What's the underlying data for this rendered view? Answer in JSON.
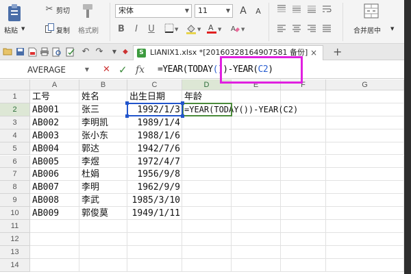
{
  "ribbon": {
    "paste_label": "粘贴",
    "cut_label": "剪切",
    "copy_label": "复制",
    "format_painter_label": "格式刷",
    "font_name": "宋体",
    "font_size": "11",
    "grow_font": "A",
    "shrink_font": "A",
    "bold": "B",
    "italic": "I",
    "underline": "U",
    "merge_label": "合并居中"
  },
  "tabbar": {
    "doc_title": "LIANIX1.xlsx *[20160328164907581 备份]",
    "doc_icon": "S",
    "close": "×",
    "add": "+"
  },
  "formula_bar": {
    "name_box": "AVERAGE",
    "cancel": "✕",
    "confirm": "✓",
    "fx": "fx",
    "formula_prefix": "=YEAR(TODAY",
    "formula_paren": "()",
    "formula_mid": ")-YEAR(",
    "formula_ref": "C2",
    "formula_end": ")"
  },
  "sheet": {
    "columns": [
      "A",
      "B",
      "C",
      "D",
      "E",
      "F",
      "G"
    ],
    "rows": [
      "1",
      "2",
      "3",
      "4",
      "5",
      "6",
      "7",
      "8",
      "9",
      "10",
      "11",
      "12",
      "13",
      "14"
    ],
    "header": [
      "工号",
      "姓名",
      "出生日期",
      "年龄"
    ],
    "data": [
      [
        "AB001",
        "张三",
        "1992/1/3"
      ],
      [
        "AB002",
        "李明凯",
        "1989/1/4"
      ],
      [
        "AB003",
        "张小东",
        "1988/1/6"
      ],
      [
        "AB004",
        "郭达",
        "1942/7/6"
      ],
      [
        "AB005",
        "李煜",
        "1972/4/7"
      ],
      [
        "AB006",
        "杜娟",
        "1956/9/8"
      ],
      [
        "AB007",
        "李明",
        "1962/9/9"
      ],
      [
        "AB008",
        "李武",
        "1985/3/10"
      ],
      [
        "AB009",
        "郭俊莫",
        "1949/1/11"
      ]
    ],
    "editing_text": "=YEAR(TODAY())-YEAR(C2)"
  },
  "colors": {
    "highlight_box": "#e020e0",
    "selection_blue": "#2255cc",
    "active_header": "#dde7d5"
  }
}
